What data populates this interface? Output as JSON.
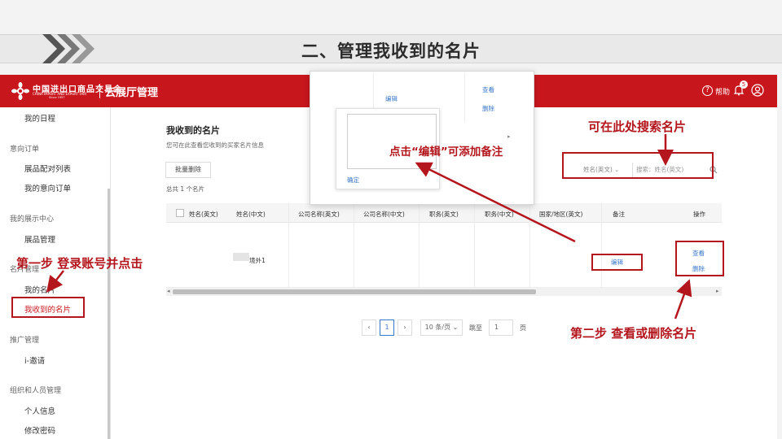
{
  "slide": {
    "title": "二、管理我收到的名片"
  },
  "header": {
    "logo_cn": "中国进出口商品交易会",
    "logo_en": "CHINA IMPORT AND EXPORT FAIR",
    "logo_since": "Since 1957",
    "app_name": "云展厅管理",
    "help_label": "帮助",
    "notification_count": "5"
  },
  "sidebar": {
    "my_schedule": "我的日程",
    "group_orders": "意向订单",
    "product_match": "展品配对列表",
    "my_orders": "我的意向订单",
    "group_display": "我的展示中心",
    "product_manage": "展品管理",
    "group_cards": "名片管理",
    "my_card": "我的名片",
    "received_cards": "我收到的名片",
    "group_promo": "推广管理",
    "invite": "i-邀请",
    "group_org": "组织和人员管理",
    "personal_info": "个人信息",
    "change_password": "修改密码"
  },
  "main": {
    "title": "我收到的名片",
    "subtitle": "您可在此查看您收到的买家名片信息",
    "batch_delete": "批量删除",
    "total": "总共 1 个名片",
    "search_field_select": "姓名(英文)",
    "search_placeholder": "搜索：姓名(英文)"
  },
  "table": {
    "columns": [
      "姓名(英文)",
      "姓名(中文)",
      "公司名称(英文)",
      "公司名称(中文)",
      "职务(英文)",
      "职务(中文)",
      "国家/地区(英文)",
      "备注",
      "操作"
    ],
    "row": {
      "name_cn": "境外1",
      "remark_edit": "编辑",
      "action_view": "查看",
      "action_delete": "删除"
    }
  },
  "pagination": {
    "current_page": "1",
    "page_size": "10 条/页",
    "goto_label": "跳至",
    "goto_value": "1",
    "page_unit": "页"
  },
  "popup": {
    "edit": "编辑",
    "view": "查看",
    "delete": "删除",
    "confirm": "确定"
  },
  "annotations": {
    "step1": "第一步   登录账号并点击",
    "step2": "第二步  查看或删除名片",
    "search_hint": "可在此处搜索名片",
    "edit_hint": "点击“编辑”可添加备注"
  },
  "colors": {
    "brand_red": "#c8161d",
    "annotation_red": "#b3161c",
    "link_blue": "#3a78c8"
  }
}
